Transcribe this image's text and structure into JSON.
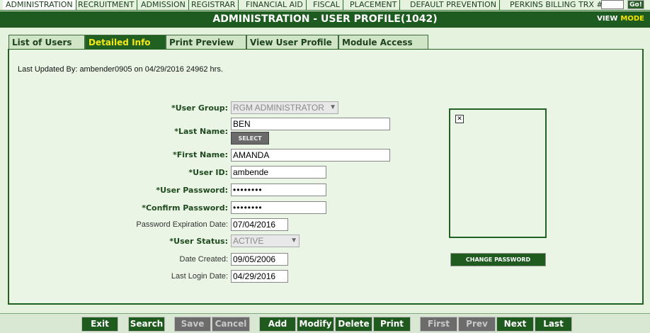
{
  "menu": {
    "items": [
      "ADMINISTRATION",
      "RECRUITMENT",
      "ADMISSION",
      "REGISTRAR",
      "FINANCIAL AID",
      "FISCAL",
      "PLACEMENT",
      "DEFAULT PREVENTION",
      "PERKINS BILLING"
    ],
    "active": "ADMINISTRATION",
    "trx_label": "TRX #:",
    "trx_value": "",
    "go_label": "Go!"
  },
  "header": {
    "title": "ADMINISTRATION - USER PROFILE(1042)",
    "view_label": "VIEW",
    "mode_label": "MODE"
  },
  "tabs": [
    "List of Users",
    "Detailed Info",
    "Print Preview",
    "View User Profile",
    "Module Access"
  ],
  "active_tab": "Detailed Info",
  "form": {
    "last_updated": "Last Updated By: ambender0905 on 04/29/2016 24962 hrs.",
    "user_group_label": "*User Group:",
    "user_group_value": "RGM ADMINISTRATOR",
    "last_name_label": "*Last Name:",
    "last_name_value": "BEN",
    "select_button": "SELECT",
    "first_name_label": "*First Name:",
    "first_name_value": "AMANDA",
    "user_id_label": "*User ID:",
    "user_id_value": "ambende",
    "user_password_label": "*User Password:",
    "user_password_value": "••••••••",
    "confirm_password_label": "*Confirm Password:",
    "confirm_password_value": "••••••••",
    "pw_expiration_label": "Password Expiration Date:",
    "pw_expiration_value": "07/04/2016",
    "user_status_label": "*User Status:",
    "user_status_value": "ACTIVE",
    "date_created_label": "Date Created:",
    "date_created_value": "09/05/2006",
    "last_login_label": "Last Login Date:",
    "last_login_value": "04/29/2016",
    "change_password_button": "CHANGE PASSWORD"
  },
  "toolbar": {
    "exit": "Exit",
    "search": "Search",
    "save": "Save",
    "cancel": "Cancel",
    "add": "Add",
    "modify": "Modify",
    "delete": "Delete",
    "print": "Print",
    "first": "First",
    "prev": "Prev",
    "next": "Next",
    "last": "Last"
  },
  "colors": {
    "brand_green": "#1e5b20",
    "tab_active_text": "#f4e81c",
    "background": "#e4f2de"
  }
}
